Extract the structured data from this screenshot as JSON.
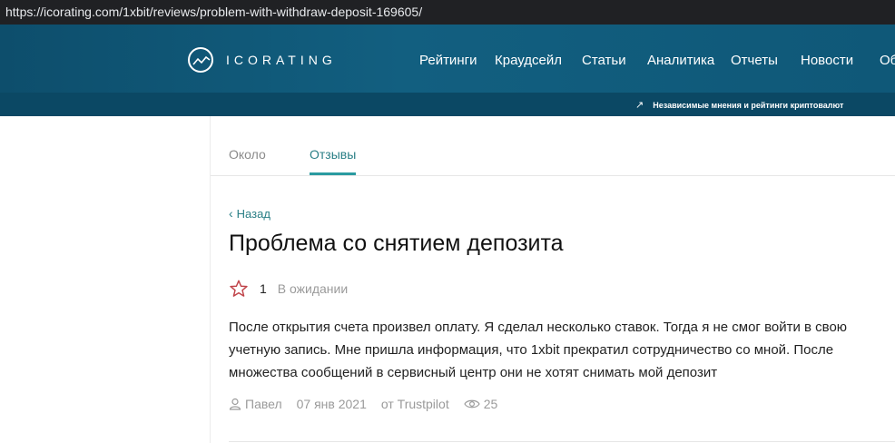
{
  "browser": {
    "url": "https://icorating.com/1xbit/reviews/problem-with-withdraw-deposit-169605/"
  },
  "header": {
    "logo_text": "ICORATING",
    "nav": [
      {
        "label": "Рейтинги"
      },
      {
        "label": "Краудсейл"
      },
      {
        "label": "Статьи"
      },
      {
        "label": "Аналитика"
      },
      {
        "label": "Отчеты"
      },
      {
        "label": "Новости"
      },
      {
        "label": "Об"
      }
    ],
    "tagline": "Независимые мнения и рейтинги криптовалют"
  },
  "tabs": [
    {
      "label": "Около"
    },
    {
      "label": "Отзывы",
      "active": true
    }
  ],
  "review": {
    "back_label": "Назад",
    "title": "Проблема со снятием депозита",
    "rating": "1",
    "status": "В ожидании",
    "text": "После открытия счета произвел оплату. Я сделал несколько ставок. Тогда я не смог войти в свою учетную запись. Мне пришла информация, что 1xbit прекратил сотрудничество со мной. После множества сообщений в сервисный центр они не хотят снимать мой депозит",
    "author": "Павел",
    "date": "07 янв 2021",
    "source": "от Trustpilot",
    "views": "25"
  },
  "colors": {
    "header_bg": "#0f5878",
    "subbar_bg": "#0b4864",
    "accent": "#2a7f86",
    "star": "#c0444a"
  },
  "icons": {
    "logo": "chart-circle-icon",
    "tagline": "arrow-up-right-icon",
    "back": "chevron-left-icon",
    "rating": "star-outline-icon",
    "author": "user-icon",
    "views": "eye-icon"
  }
}
